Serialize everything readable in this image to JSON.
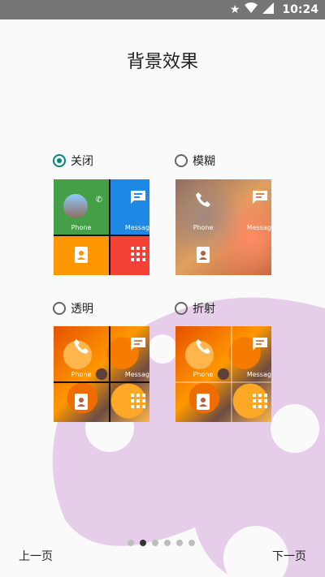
{
  "status_bar": {
    "time": "10:24",
    "icons": [
      "star-icon",
      "wifi-icon",
      "signal-icon"
    ]
  },
  "title": "背景效果",
  "options": [
    {
      "label": "关闭",
      "selected": true
    },
    {
      "label": "模糊",
      "selected": false
    },
    {
      "label": "透明",
      "selected": false
    },
    {
      "label": "折射",
      "selected": false
    }
  ],
  "tiles": {
    "phone": "Phone",
    "messaging": "Messagi"
  },
  "colors": {
    "accent": "#00897b",
    "phone_tile": "#43a047",
    "messaging_tile": "#1e88e5",
    "contacts_tile": "#ff9800",
    "apps_tile": "#f44336",
    "blob": "#e6cde9"
  },
  "pager": {
    "prev": "上一页",
    "next": "下一页",
    "total": 6,
    "current": 2
  }
}
